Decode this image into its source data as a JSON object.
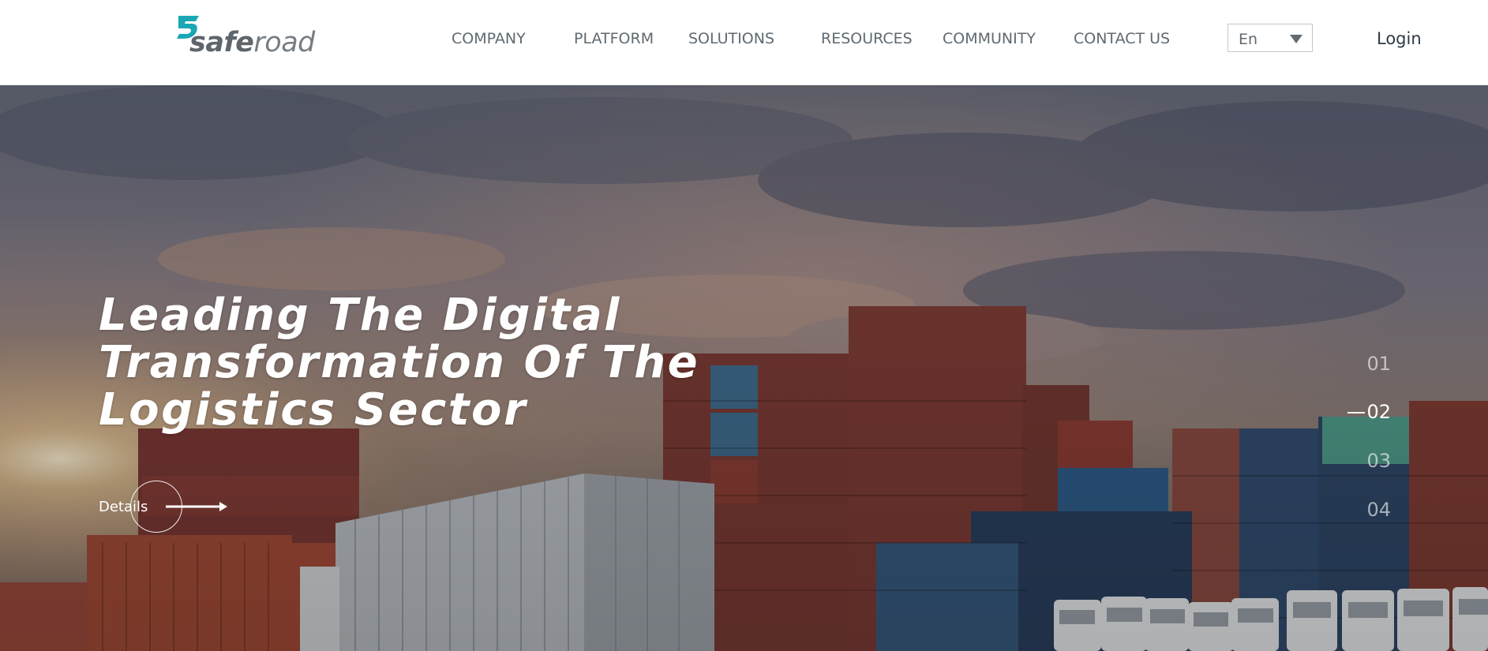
{
  "brand": {
    "logo_prefix": "safe",
    "logo_suffix": "road",
    "logo_mark_color": "#1aa7b5"
  },
  "nav": {
    "items": [
      {
        "label": "COMPANY"
      },
      {
        "label": "PLATFORM"
      },
      {
        "label": "SOLUTIONS"
      },
      {
        "label": "RESOURCES"
      },
      {
        "label": "COMMUNITY"
      },
      {
        "label": "CONTACT US"
      }
    ]
  },
  "language": {
    "selected": "En",
    "icon": "caret-down-icon"
  },
  "login": {
    "label": "Login"
  },
  "hero": {
    "title": "Leading The Digital Transformation Of The Logistics Sector",
    "details_label": "Details",
    "details_icon": "arrow-right-icon",
    "slides": [
      "01",
      "02",
      "03",
      "04"
    ],
    "active_slide": "02"
  }
}
